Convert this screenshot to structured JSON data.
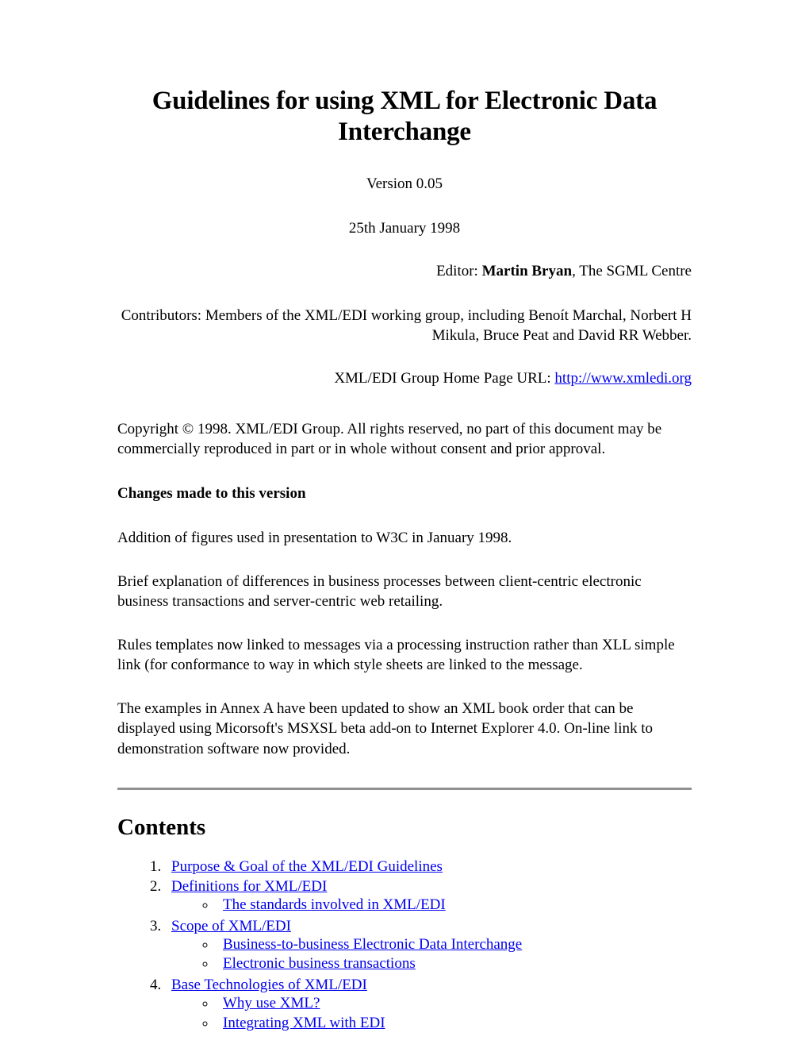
{
  "document": {
    "title": "Guidelines for using XML for Electronic Data Interchange",
    "version": "Version 0.05",
    "date": "25th January 1998",
    "editor_prefix": "Editor: ",
    "editor_name": "Martin Bryan",
    "editor_suffix": ", The SGML Centre",
    "contributors": "Contributors: Members of the XML/EDI working group, including Benoít Marchal, Norbert H Mikula, Bruce Peat and David RR Webber.",
    "homepage_label": "XML/EDI Group Home Page URL: ",
    "homepage_url_text": "http://www.xmledi.org",
    "copyright": "Copyright © 1998. XML/EDI Group. All rights reserved, no part of this document may be commercially reproduced in part or in whole without consent and prior approval."
  },
  "changes": {
    "heading": "Changes made to this version",
    "paragraphs": [
      "Addition of figures used in presentation to W3C in January 1998.",
      "Brief explanation of differences in business processes between client-centric electronic business transactions and server-centric web retailing.",
      "Rules templates now linked to messages via a processing instruction rather than XLL simple link (for conformance to way in which style sheets are linked to the message.",
      "The examples in Annex A have been updated to show an XML book order that can be displayed using Micorsoft's MSXSL beta add-on to Internet Explorer 4.0. On-line link to demonstration software now provided."
    ]
  },
  "contents": {
    "heading": "Contents",
    "items": [
      {
        "label": "Purpose & Goal of the XML/EDI Guidelines",
        "children": []
      },
      {
        "label": "Definitions for XML/EDI",
        "children": [
          "The standards involved in XML/EDI"
        ]
      },
      {
        "label": "Scope of XML/EDI",
        "children": [
          "Business-to-business Electronic Data Interchange",
          "Electronic business transactions"
        ]
      },
      {
        "label": "Base Technologies of XML/EDI ",
        "children": [
          "Why use XML?",
          "Integrating XML with EDI"
        ]
      }
    ]
  },
  "colors": {
    "link": "#0000ee",
    "rule": "#909090",
    "text": "#000000",
    "background": "#ffffff"
  }
}
